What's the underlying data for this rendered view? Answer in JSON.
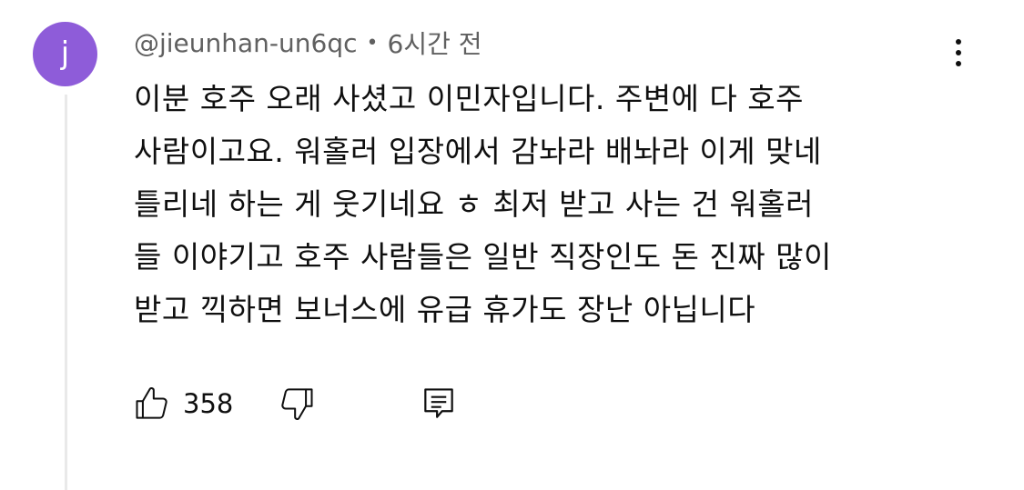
{
  "comment": {
    "avatar_letter": "j",
    "avatar_color": "#8e5cd9",
    "author": "@jieunhan-un6qc",
    "separator": "•",
    "time": "6시간 전",
    "text_lines": [
      "이분 호주 오래 사셨고 이민자입니다. 주변에 다 호주",
      "사람이고요. 워홀러 입장에서 감놔라 배놔라 이게 맞네",
      "틀리네 하는 게 웃기네요 ㅎ 최저 받고 사는 건 워홀러",
      "들 이야기고 호주 사람들은 일반 직장인도 돈 진짜 많이",
      "받고 끽하면 보너스에 유급 휴가도 장난 아닙니다"
    ],
    "like_count": "358"
  },
  "icons": {
    "like": "thumbs-up-icon",
    "dislike": "thumbs-down-icon",
    "reply": "comment-icon",
    "more": "more-vert-icon"
  }
}
